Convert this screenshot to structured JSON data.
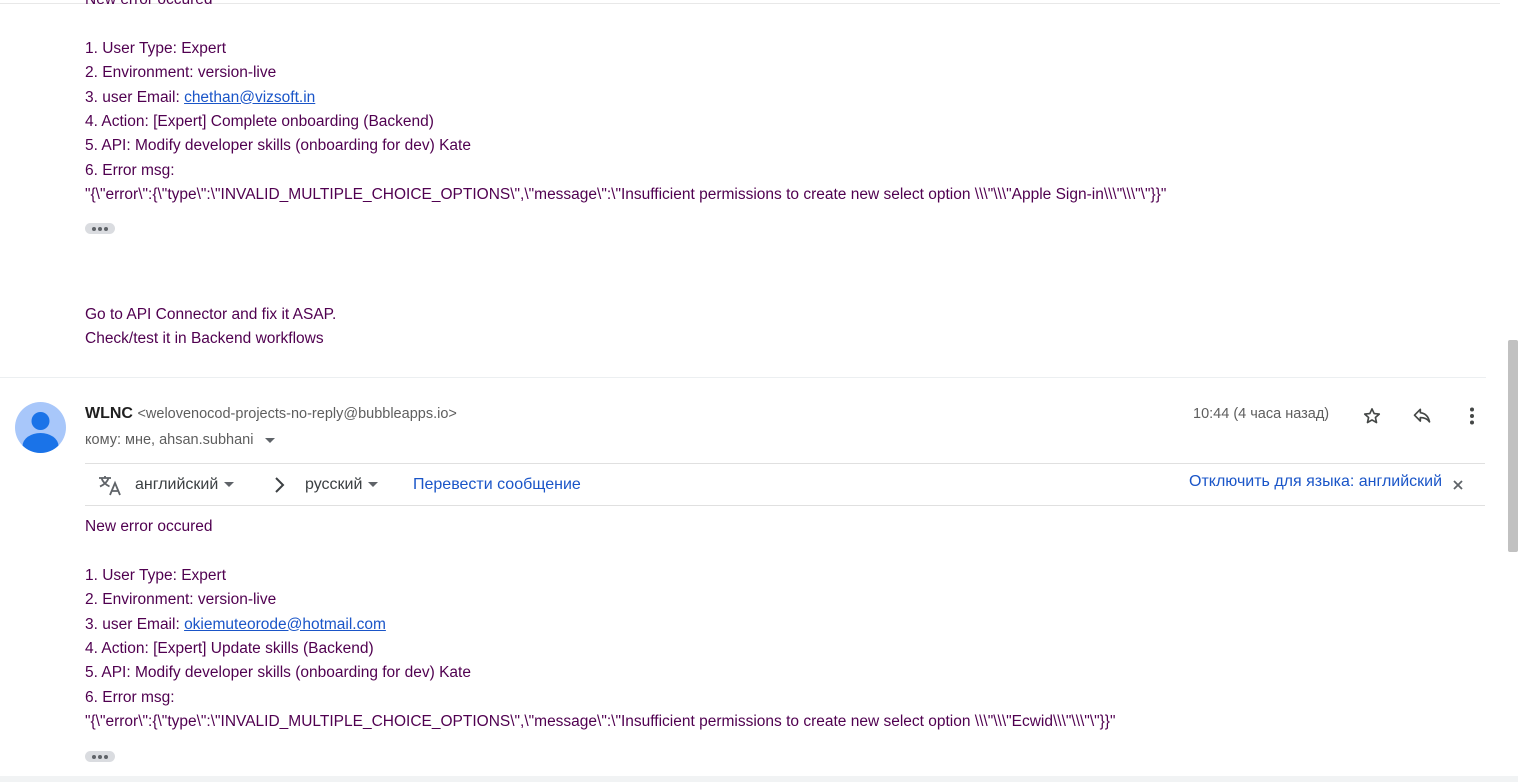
{
  "email1": {
    "heading_cut": "New error occured",
    "lines": [
      "1. User Type: Expert",
      "2. Environment: version-live"
    ],
    "email_prefix": "3. user Email: ",
    "email_link": "chethan@vizsoft.in",
    "lines2": [
      "4. Action: [Expert] Complete onboarding (Backend)",
      "5. API: Modify developer skills (onboarding for dev) Kate",
      "6. Error msg:",
      "\"{\\\"error\\\":{\\\"type\\\":\\\"INVALID_MULTIPLE_CHOICE_OPTIONS\\\",\\\"message\\\":\\\"Insufficient permissions to create new select option \\\\\\\"\\\\\\\"Apple Sign-in\\\\\\\"\\\\\\\"\\\"}}\""
    ],
    "footer_lines": [
      "Go to API Connector and fix it ASAP.",
      "Check/test it in Backend workflows"
    ]
  },
  "email2": {
    "sender_name": "WLNC",
    "sender_email": "<welovenocod-projects-no-reply@bubbleapps.io>",
    "recipients": "кому: мне, ahsan.subhani",
    "time": "10:44 (4 часа назад)",
    "translate": {
      "from_lang": "английский",
      "to_lang": "русский",
      "translate_label": "Перевести сообщение",
      "disable_label": "Отключить для языка: английский"
    },
    "heading": "New error occured",
    "lines": [
      "1. User Type: Expert",
      "2. Environment: version-live"
    ],
    "email_prefix": "3. user Email: ",
    "email_link": "okiemuteorode@hotmail.com",
    "lines2": [
      "4. Action: [Expert] Update skills (Backend)",
      "5. API: Modify developer skills (onboarding for dev) Kate",
      "6. Error msg:",
      "\"{\\\"error\\\":{\\\"type\\\":\\\"INVALID_MULTIPLE_CHOICE_OPTIONS\\\",\\\"message\\\":\\\"Insufficient permissions to create new select option \\\\\\\"\\\\\\\"Ecwid\\\\\\\"\\\\\\\"\\\"}}\""
    ]
  },
  "icons": {
    "star": "star-icon",
    "reply": "reply-icon",
    "more": "more-vert-icon",
    "translate": "translate-icon",
    "close": "close-icon"
  },
  "colors": {
    "body_text": "#500050",
    "link": "#1a55c8",
    "avatar_bg": "#a8c7fa",
    "avatar_fg": "#1a73e8"
  }
}
